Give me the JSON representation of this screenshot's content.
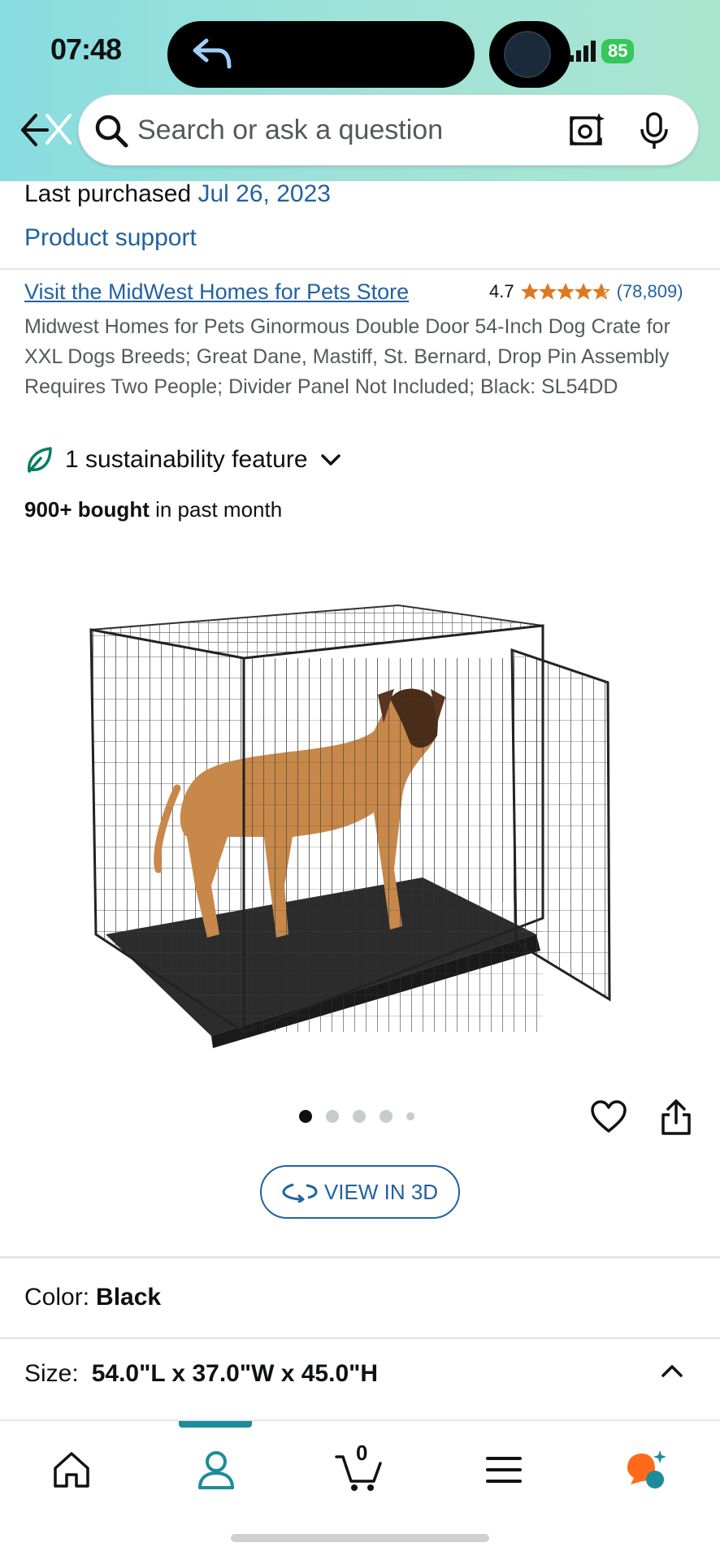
{
  "status_bar": {
    "time": "07:48",
    "battery": "85"
  },
  "search": {
    "placeholder": "Search or ask a question"
  },
  "purchase": {
    "label": "Last purchased",
    "date": "Jul 26, 2023",
    "support_link": "Product support"
  },
  "product": {
    "store_link": "Visit the MidWest Homes for Pets Store",
    "rating": "4.7",
    "stars": 4.7,
    "rating_count": "(78,809)",
    "title": "Midwest Homes for Pets Ginormous Double Door 54-Inch Dog Crate for XXL Dogs Breeds; Great Dane, Mastiff, St. Bernard, Drop Pin Assembly Requires Two People; Divider Panel Not Included; Black: SL54DD",
    "sustainability": "1 sustainability feature",
    "bought_bold": "900+ bought",
    "bought_rest": " in past month",
    "image_count": 5,
    "active_image": 1,
    "view_3d": "VIEW IN 3D"
  },
  "options": {
    "color_label": "Color:",
    "color_value": "Black",
    "size_label": "Size:",
    "size_value": "54.0\"L x 37.0\"W x 45.0\"H"
  },
  "bottom_nav": {
    "cart_count": "0",
    "active_tab": "you"
  },
  "colors": {
    "link": "#2162a1",
    "star": "#de7921",
    "accent": "#1c8c9b"
  }
}
